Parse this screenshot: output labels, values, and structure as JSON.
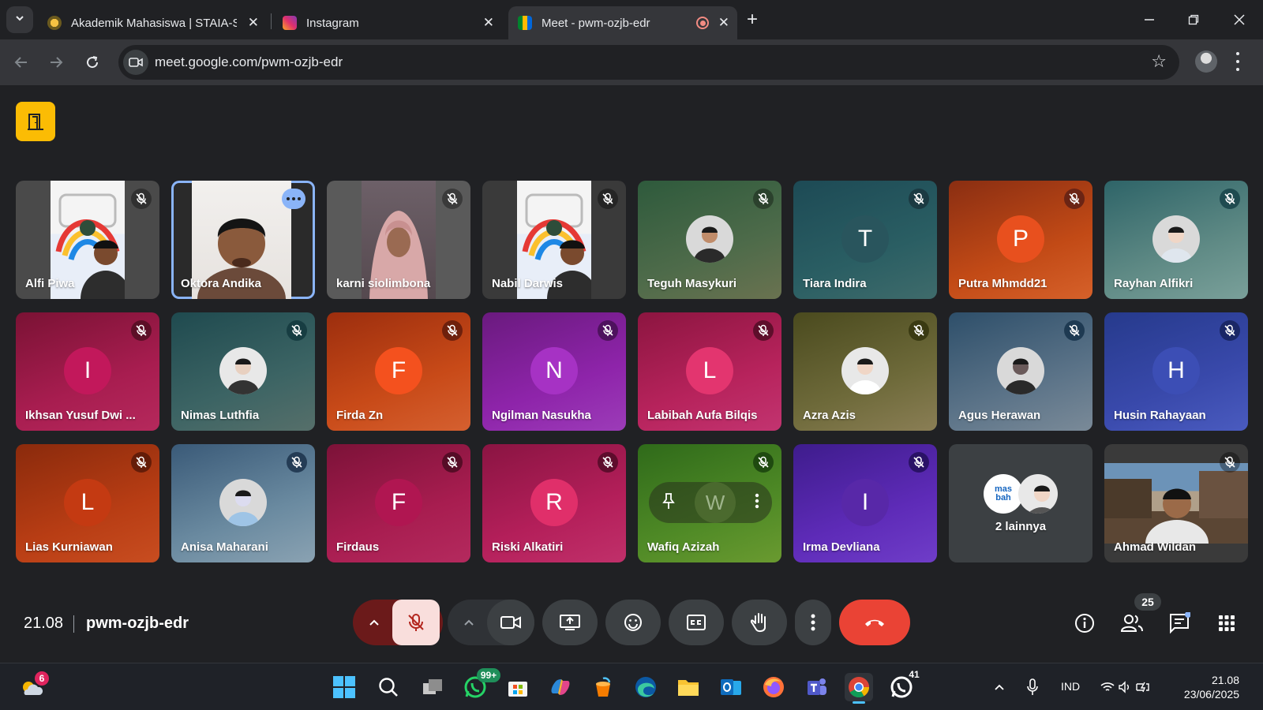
{
  "browser": {
    "tabs": [
      {
        "title": "Akademik Mahasiswa | STAIA-S",
        "active": false
      },
      {
        "title": "Instagram",
        "active": false
      },
      {
        "title": "Meet - pwm-ozjb-edr",
        "active": true,
        "recording": true
      }
    ],
    "url": "meet.google.com/pwm-ozjb-edr"
  },
  "meet": {
    "participants": [
      {
        "name": "Alfi Piwa",
        "kind": "video",
        "muted": true
      },
      {
        "name": "Oktora Andika",
        "kind": "video",
        "muted": false,
        "selected": true
      },
      {
        "name": "karni siolimbona",
        "kind": "video",
        "muted": true
      },
      {
        "name": "Nabil Darwis",
        "kind": "video",
        "muted": true
      },
      {
        "name": "Teguh Masykuri",
        "kind": "photo",
        "muted": true
      },
      {
        "name": "Tiara Indira",
        "kind": "letter",
        "letter": "T",
        "muted": true
      },
      {
        "name": "Putra Mhmdd21",
        "kind": "letter",
        "letter": "P",
        "muted": true
      },
      {
        "name": "Rayhan Alfikri",
        "kind": "photo",
        "muted": true
      },
      {
        "name": "Ikhsan Yusuf Dwi ...",
        "kind": "letter",
        "letter": "I",
        "muted": true
      },
      {
        "name": "Nimas Luthfia",
        "kind": "photo",
        "muted": true
      },
      {
        "name": "Firda Zn",
        "kind": "letter",
        "letter": "F",
        "muted": true
      },
      {
        "name": "Ngilman Nasukha",
        "kind": "letter",
        "letter": "N",
        "muted": true
      },
      {
        "name": "Labibah Aufa Bilqis",
        "kind": "letter",
        "letter": "L",
        "muted": true
      },
      {
        "name": "Azra Azis",
        "kind": "photo",
        "muted": true
      },
      {
        "name": "Agus Herawan",
        "kind": "photo",
        "muted": true
      },
      {
        "name": "Husin Rahayaan",
        "kind": "letter",
        "letter": "H",
        "muted": true
      },
      {
        "name": "Lias Kurniawan",
        "kind": "letter",
        "letter": "L",
        "muted": true
      },
      {
        "name": "Anisa Maharani",
        "kind": "photo",
        "muted": true
      },
      {
        "name": "Firdaus",
        "kind": "letter",
        "letter": "F",
        "muted": true
      },
      {
        "name": "Riski Alkatiri",
        "kind": "letter",
        "letter": "R",
        "muted": true
      },
      {
        "name": "Wafiq Azizah",
        "kind": "hover",
        "letter": "W",
        "muted": true
      },
      {
        "name": "Irma Devliana",
        "kind": "letter",
        "letter": "I",
        "muted": true
      },
      {
        "name": "2 lainnya",
        "kind": "others",
        "muted": false
      },
      {
        "name": "Ahmad Wildan",
        "kind": "video",
        "muted": true
      }
    ],
    "others_logo_text": "mas bah",
    "time": "21.08",
    "meeting_code": "pwm-ozjb-edr",
    "participant_count": "25"
  },
  "taskbar": {
    "weather_badge": "6",
    "whatsapp_badge": "99+",
    "whatsapp2_badge": "41",
    "language": "IND",
    "time": "21.08",
    "date": "23/06/2025"
  },
  "colors": {
    "accent": "#8ab4f8",
    "end_call": "#ea4335",
    "mic_off_bg": "#f9dedc",
    "mic_off_icon": "#b3261e"
  }
}
